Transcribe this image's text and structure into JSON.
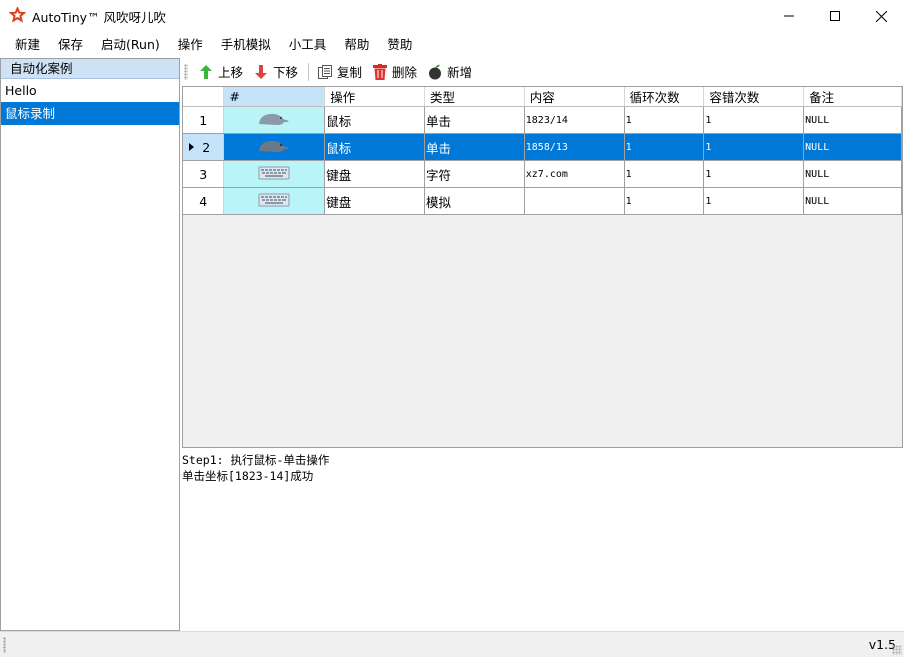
{
  "window": {
    "title": "AutoTiny™ 风吹呀儿吹",
    "accent": "#0078d7"
  },
  "menu": [
    "新建",
    "保存",
    "启动(Run)",
    "操作",
    "手机模拟",
    "小工具",
    "帮助",
    "赞助"
  ],
  "sidebar": {
    "header": "自动化案例",
    "items": [
      {
        "label": "Hello",
        "selected": false
      },
      {
        "label": "鼠标录制",
        "selected": true
      }
    ]
  },
  "toolbar": {
    "up": "上移",
    "down": "下移",
    "copy": "复制",
    "delete": "删除",
    "add": "新增"
  },
  "grid": {
    "columns": [
      "#",
      "操作",
      "类型",
      "内容",
      "循环次数",
      "容错次数",
      "备注"
    ],
    "rows": [
      {
        "num": "1",
        "icon": "mouse-icon",
        "op": "鼠标",
        "type": "单击",
        "content": "1823/14",
        "loop": "1",
        "retry": "1",
        "note": "NULL",
        "selected": false
      },
      {
        "num": "2",
        "icon": "mouse-icon",
        "op": "鼠标",
        "type": "单击",
        "content": "1858/13",
        "loop": "1",
        "retry": "1",
        "note": "NULL",
        "selected": true
      },
      {
        "num": "3",
        "icon": "keyboard-icon",
        "op": "键盘",
        "type": "字符",
        "content": "xz7.com",
        "loop": "1",
        "retry": "1",
        "note": "NULL",
        "selected": false
      },
      {
        "num": "4",
        "icon": "keyboard-icon",
        "op": "键盘",
        "type": "模拟",
        "content": "",
        "loop": "1",
        "retry": "1",
        "note": "NULL",
        "selected": false
      }
    ]
  },
  "log": {
    "lines": [
      "Step1: 执行鼠标-单击操作",
      "单击坐标[1823-14]成功"
    ]
  },
  "status": {
    "version": "v1.5"
  }
}
